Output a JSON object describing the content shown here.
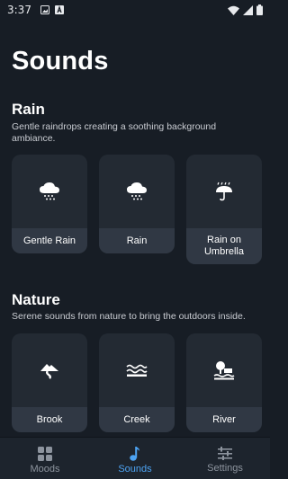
{
  "status_bar": {
    "time": "3:37"
  },
  "page": {
    "title": "Sounds"
  },
  "sections": [
    {
      "title": "Rain",
      "description": "Gentle raindrops creating a soothing background ambiance.",
      "items": [
        {
          "label": "Gentle Rain",
          "icon": "rain-cloud-icon"
        },
        {
          "label": "Rain",
          "icon": "rain-cloud-icon"
        },
        {
          "label": "Rain on Umbrella",
          "icon": "umbrella-rain-icon"
        }
      ]
    },
    {
      "title": "Nature",
      "description": "Serene sounds from nature to bring the outdoors inside.",
      "items": [
        {
          "label": "Brook",
          "icon": "brook-icon"
        },
        {
          "label": "Creek",
          "icon": "waves-icon"
        },
        {
          "label": "River",
          "icon": "river-tree-icon"
        }
      ]
    }
  ],
  "bottom_nav": {
    "items": [
      {
        "label": "Moods",
        "icon": "grid-icon",
        "active": false
      },
      {
        "label": "Sounds",
        "icon": "music-note-icon",
        "active": true
      },
      {
        "label": "Settings",
        "icon": "sliders-icon",
        "active": false
      }
    ]
  },
  "colors": {
    "background": "#171d25",
    "card": "#232a33",
    "card_label": "#303844",
    "accent": "#4da3f2"
  }
}
